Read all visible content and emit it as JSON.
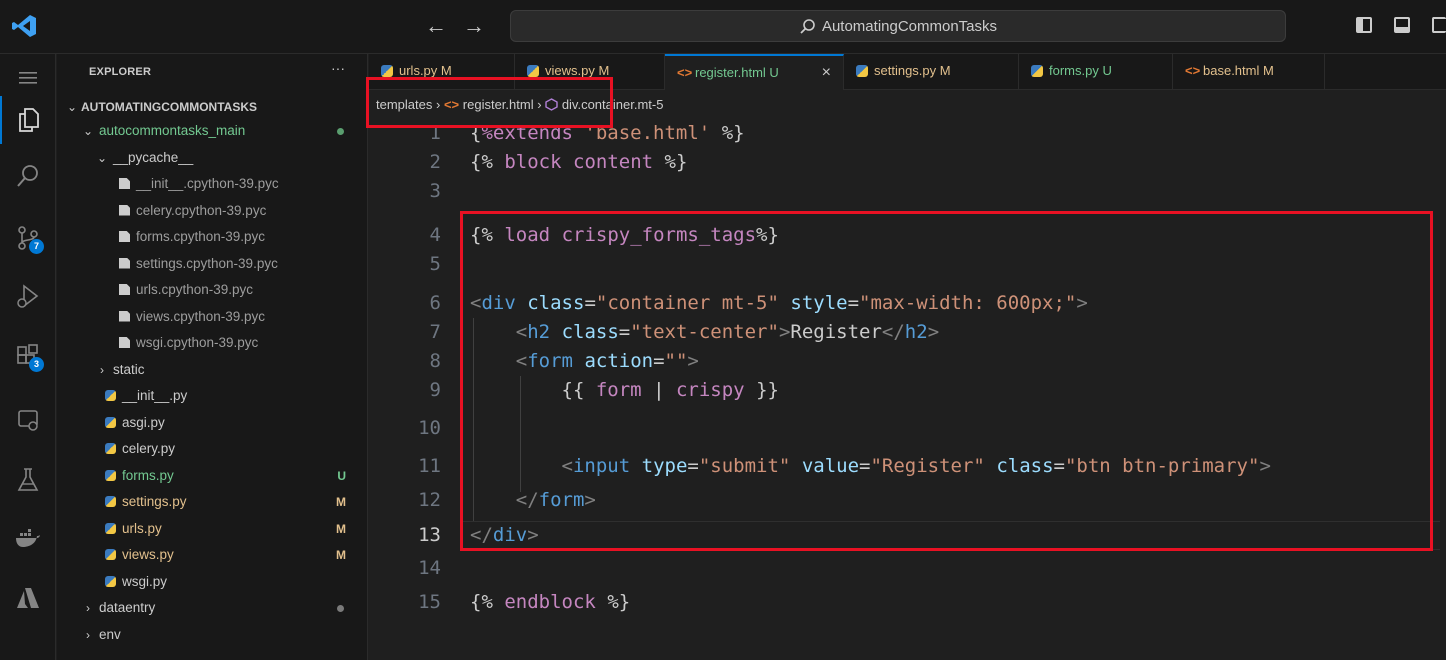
{
  "titlebar": {
    "search_text": "AutomatingCommonTasks",
    "back": "←",
    "forward": "→"
  },
  "explorer": {
    "header": "EXPLORER",
    "more": "···",
    "root": "AUTOMATINGCOMMONTASKS",
    "items": [
      {
        "label": "autocommontasks_main",
        "kind": "folder-open",
        "indent": 1,
        "status": "dot-green"
      },
      {
        "label": "__pycache__",
        "kind": "folder-open",
        "indent": 2,
        "status": ""
      },
      {
        "label": "__init__.cpython-39.pyc",
        "kind": "pyc",
        "indent": 3,
        "status": ""
      },
      {
        "label": "celery.cpython-39.pyc",
        "kind": "pyc",
        "indent": 3,
        "status": ""
      },
      {
        "label": "forms.cpython-39.pyc",
        "kind": "pyc",
        "indent": 3,
        "status": ""
      },
      {
        "label": "settings.cpython-39.pyc",
        "kind": "pyc",
        "indent": 3,
        "status": ""
      },
      {
        "label": "urls.cpython-39.pyc",
        "kind": "pyc",
        "indent": 3,
        "status": ""
      },
      {
        "label": "views.cpython-39.pyc",
        "kind": "pyc",
        "indent": 3,
        "status": ""
      },
      {
        "label": "wsgi.cpython-39.pyc",
        "kind": "pyc",
        "indent": 3,
        "status": ""
      },
      {
        "label": "static",
        "kind": "folder-closed",
        "indent": 2,
        "status": ""
      },
      {
        "label": "__init__.py",
        "kind": "py",
        "indent": 2,
        "status": ""
      },
      {
        "label": "asgi.py",
        "kind": "py",
        "indent": 2,
        "status": ""
      },
      {
        "label": "celery.py",
        "kind": "py",
        "indent": 2,
        "status": ""
      },
      {
        "label": "forms.py",
        "kind": "py",
        "indent": 2,
        "status": "U"
      },
      {
        "label": "settings.py",
        "kind": "py",
        "indent": 2,
        "status": "M"
      },
      {
        "label": "urls.py",
        "kind": "py",
        "indent": 2,
        "status": "M"
      },
      {
        "label": "views.py",
        "kind": "py",
        "indent": 2,
        "status": "M"
      },
      {
        "label": "wsgi.py",
        "kind": "py",
        "indent": 2,
        "status": ""
      },
      {
        "label": "dataentry",
        "kind": "folder-closed",
        "indent": 1,
        "status": "dot-grey"
      },
      {
        "label": "env",
        "kind": "folder-closed",
        "indent": 1,
        "status": ""
      }
    ]
  },
  "tabs": [
    {
      "label": "urls.py",
      "status": "M",
      "icon": "py",
      "active": false
    },
    {
      "label": "views.py",
      "status": "M",
      "icon": "py",
      "active": false
    },
    {
      "label": "register.html",
      "status": "U",
      "icon": "html",
      "active": true,
      "close": "×"
    },
    {
      "label": "settings.py",
      "status": "M",
      "icon": "py",
      "active": false
    },
    {
      "label": "forms.py",
      "status": "U",
      "icon": "py",
      "active": false
    },
    {
      "label": "base.html",
      "status": "M",
      "icon": "html",
      "active": false
    }
  ],
  "breadcrumb": {
    "folder": "templates",
    "sep1": "›",
    "file": "register.html",
    "sep2": "›",
    "symbol": "div.container.mt-5"
  },
  "badges": {
    "source_control": "7",
    "extensions": "3"
  },
  "editor": {
    "current_line": 13,
    "line_numbers": [
      "1",
      "2",
      "3",
      "4",
      "5",
      "6",
      "7",
      "8",
      "9",
      "10",
      "11",
      "12",
      "13",
      "14",
      "15"
    ]
  },
  "colors": {
    "accent": "#0078d4",
    "highlight": "#e81123",
    "untracked": "#73c991",
    "modified": "#e2c08d"
  }
}
